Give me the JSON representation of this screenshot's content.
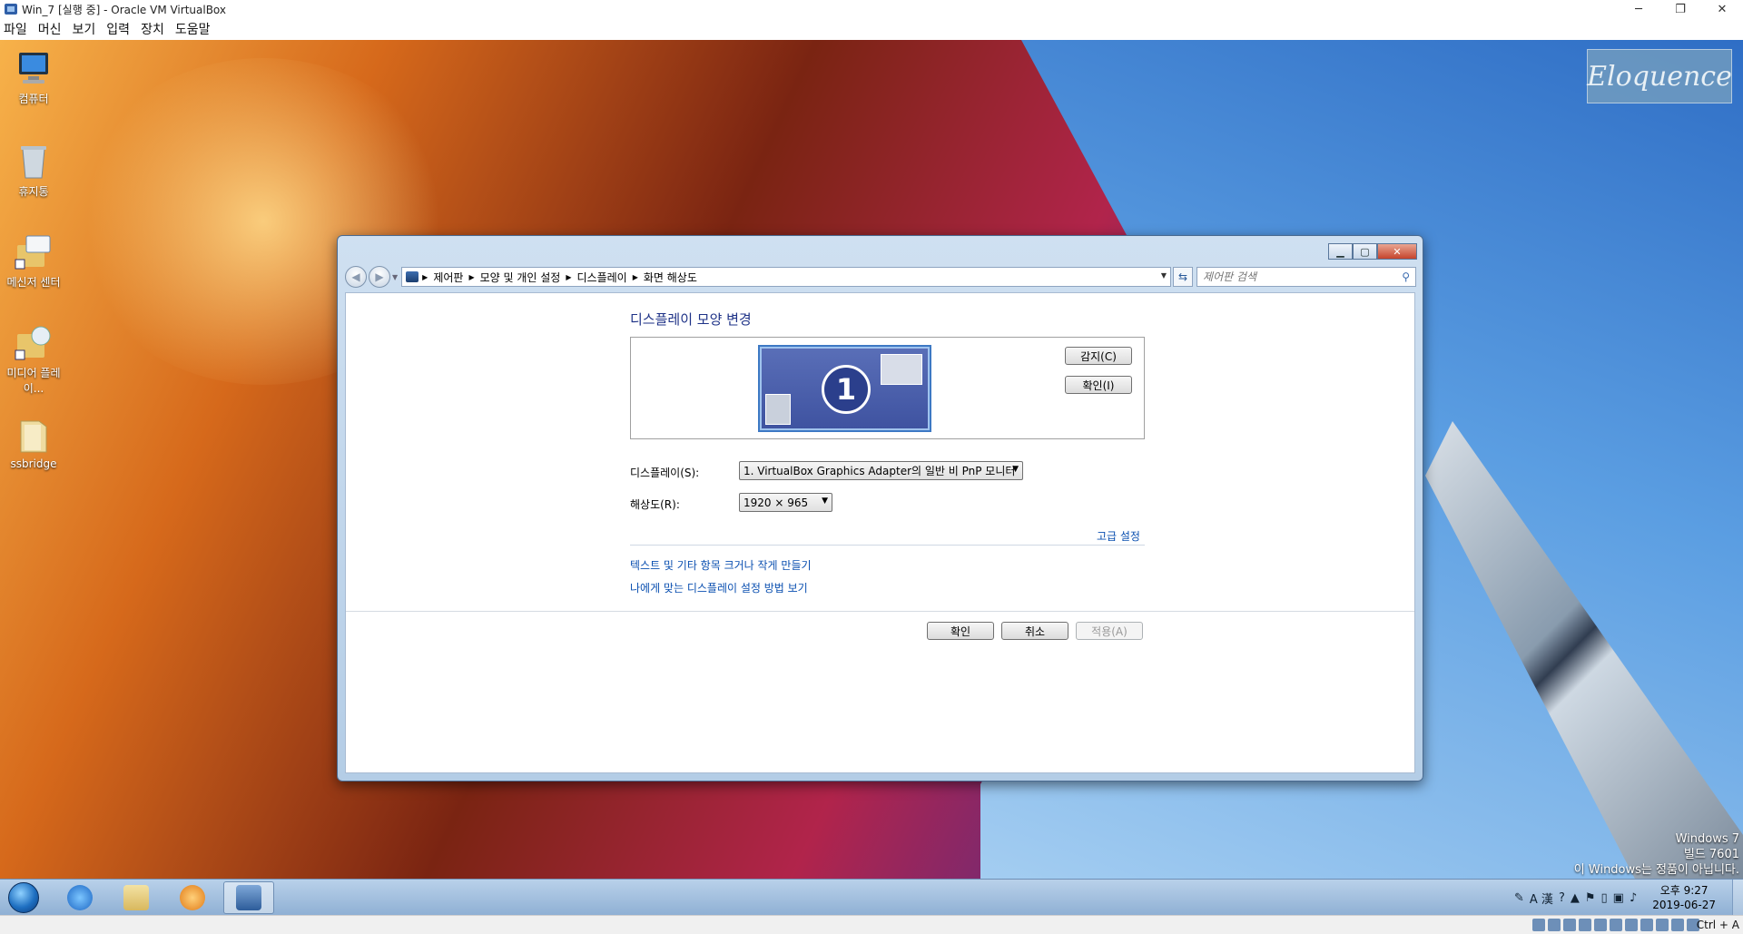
{
  "host": {
    "title": "Win_7 [실행 중] - Oracle VM VirtualBox",
    "window_controls": [
      "─",
      "❐",
      "✕"
    ],
    "menu": [
      "파일",
      "머신",
      "보기",
      "입력",
      "장치",
      "도움말"
    ],
    "hostkey": "Ctrl + A"
  },
  "desktop": {
    "icons": [
      {
        "label": "컴퓨터",
        "icon": "computer-icon"
      },
      {
        "label": "휴지통",
        "icon": "recycle-bin-icon"
      },
      {
        "label": "메신저 센터",
        "icon": "messenger-center-icon"
      },
      {
        "label": "미디어 플레이...",
        "icon": "media-player-icon"
      },
      {
        "label": "ssbridge",
        "icon": "folder-icon"
      }
    ],
    "logo": "Eloquence",
    "version_lines": [
      "Windows 7",
      "빌드 7601",
      "이 Windows는 정품이 아닙니다."
    ]
  },
  "taskbar": {
    "clock_time": "오후 9:27",
    "clock_date": "2019-06-27",
    "tray_ime": "A 漢"
  },
  "window": {
    "breadcrumb": [
      "제어판",
      "모양 및 개인 설정",
      "디스플레이",
      "화면 해상도"
    ],
    "search_placeholder": "제어판 검색",
    "heading": "디스플레이 모양 변경",
    "monitor_number": "1",
    "detect_button": "감지(C)",
    "identify_button": "확인(I)",
    "display_label": "디스플레이(S):",
    "display_value": "1. VirtualBox Graphics Adapter의 일반 비 PnP 모니터",
    "resolution_label": "해상도(R):",
    "resolution_value": "1920 × 965",
    "advanced_link": "고급 설정",
    "link_text_size": "텍스트 및 기타 항목 크거나 작게 만들기",
    "link_help": "나에게 맞는 디스플레이 설정 방법 보기",
    "ok_button": "확인",
    "cancel_button": "취소",
    "apply_button": "적용(A)"
  }
}
